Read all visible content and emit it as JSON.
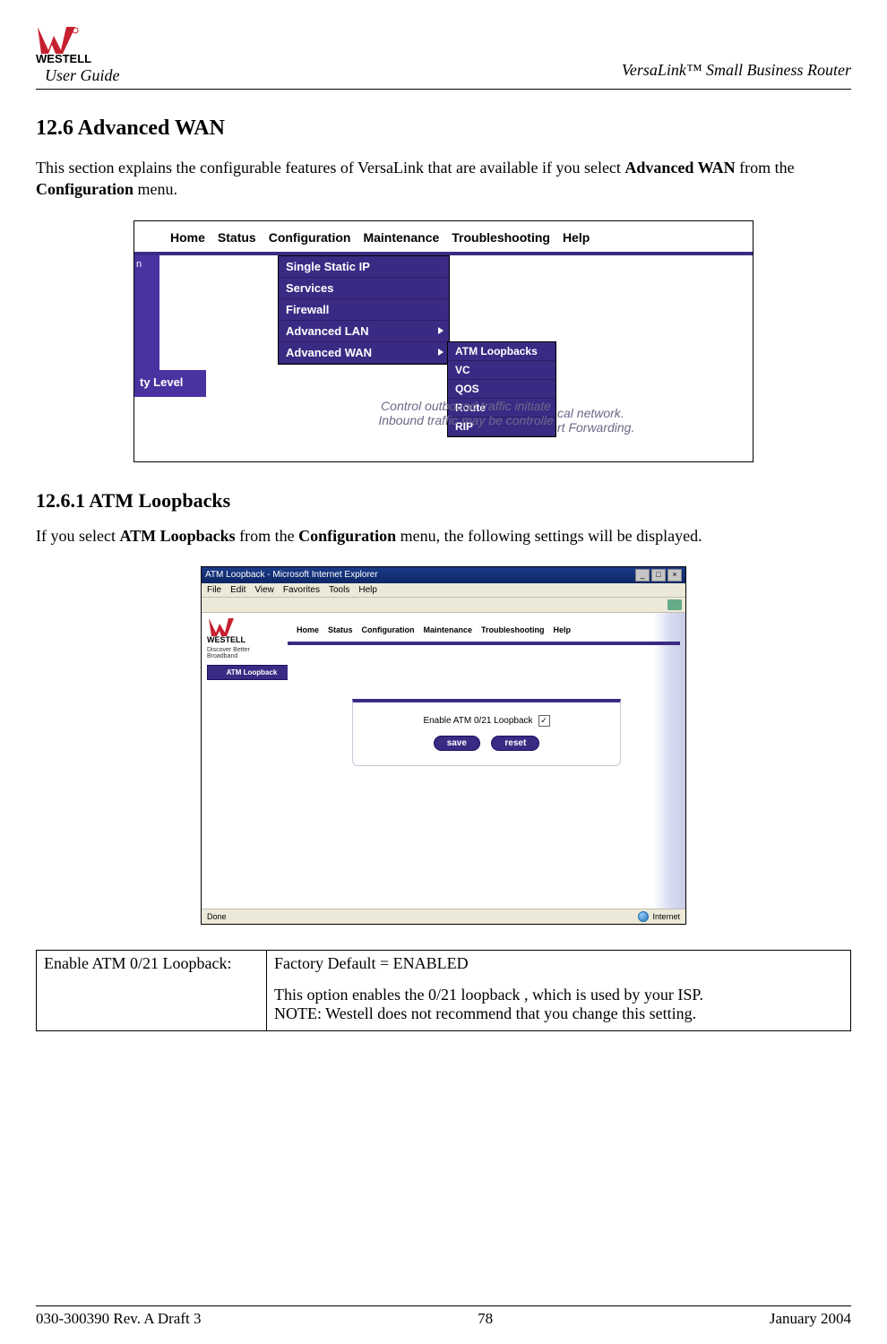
{
  "header": {
    "user_guide": "User Guide",
    "product": "VersaLink™  Small Business Router",
    "logo_word": "WESTELL"
  },
  "section": {
    "h2": "12.6  Advanced WAN",
    "intro_pre": "This section explains the configurable features of VersaLink that are available if you select ",
    "intro_b1": "Advanced WAN",
    "intro_mid": " from the ",
    "intro_b2": "Configuration",
    "intro_post": " menu.",
    "h3": "12.6.1   ATM Loopbacks",
    "p2_pre": "If you select ",
    "p2_b1": "ATM Loopbacks",
    "p2_mid": " from the ",
    "p2_b2": "Configuration",
    "p2_post": " menu, the following settings will be displayed."
  },
  "shot1": {
    "tabs": [
      "Home",
      "Status",
      "Configuration",
      "Maintenance",
      "Troubleshooting",
      "Help"
    ],
    "left_frag_top": "n",
    "ty_level": "ty Level",
    "menu": [
      "Single Static IP",
      "Services",
      "Firewall",
      "Advanced LAN",
      "Advanced WAN"
    ],
    "submenu": [
      "ATM Loopbacks",
      "VC",
      "QOS",
      "Route",
      "RIP"
    ],
    "blurb_l1_left": "Control outbound traffic initiate",
    "blurb_l1_right": "cal network.",
    "blurb_l2_left": "Inbound traffic may be controlle",
    "blurb_l2_right": "rt Forwarding."
  },
  "shot2": {
    "title": "ATM Loopback - Microsoft Internet Explorer",
    "menus": [
      "File",
      "Edit",
      "View",
      "Favorites",
      "Tools",
      "Help"
    ],
    "logo_word": "WESTELL",
    "tagline": "Discover Better Broadband",
    "chip": "ATM Loopback",
    "tabs": [
      "Home",
      "Status",
      "Configuration",
      "Maintenance",
      "Troubleshooting",
      "Help"
    ],
    "panel_label": "Enable ATM 0/21 Loopback",
    "btn_save": "save",
    "btn_reset": "reset",
    "status_left": "Done",
    "status_right": "Internet"
  },
  "opts": {
    "k": "Enable ATM 0/21 Loopback:",
    "v_line1": "Factory Default = ENABLED",
    "v_line2": "This option enables the 0/21 loopback , which is used by your ISP.",
    "v_line3": "NOTE: Westell does not recommend that you change this setting."
  },
  "footer": {
    "left": "030-300390 Rev. A Draft 3",
    "center": "78",
    "right": "January 2004"
  }
}
